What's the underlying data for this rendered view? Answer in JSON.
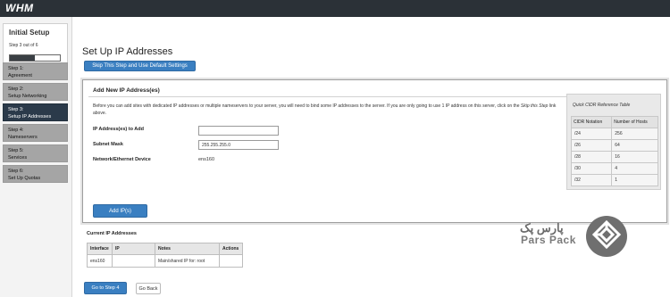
{
  "app": {
    "logo_text": "WHM"
  },
  "sidebar": {
    "setup_title": "Initial Setup",
    "setup_progress_text": "Step 3 out of 6",
    "progress_fraction": 0.5,
    "steps": [
      {
        "num": "Step 1:",
        "title": "Agreement",
        "active": false
      },
      {
        "num": "Step 2:",
        "title": "Setup Networking",
        "active": false
      },
      {
        "num": "Step 3:",
        "title": "Setup IP Addresses",
        "active": true
      },
      {
        "num": "Step 4:",
        "title": "Nameservers",
        "active": false
      },
      {
        "num": "Step 5:",
        "title": "Services",
        "active": false
      },
      {
        "num": "Step 6:",
        "title": "Set Up Quotas",
        "active": false
      }
    ]
  },
  "main": {
    "title": "Set Up IP Addresses",
    "skip_button": "Skip This Step and Use Default Settings",
    "panel_title": "Add New IP Address(es)",
    "description_part1": "Before you can add sites with dedicated IP addresses or multiple nameservers to your server, you will need to bind some IP addresses to the server. If you are only going to use 1 IP address on this server, click on the ",
    "description_link": "Skip this Step",
    "description_part2": " link above.",
    "form": {
      "ip_label": "IP Address(es) to Add",
      "ip_value": "",
      "subnet_label": "Subnet Mask",
      "subnet_value": "255.255.255.0",
      "device_label": "Network/Ethernet Device",
      "device_value": "ens160"
    },
    "add_button": "Add IP(s)",
    "cidr_table": {
      "title": "Quick CIDR Reference Table",
      "headers": [
        "CIDR Notation",
        "Number of Hosts"
      ],
      "rows": [
        [
          "/24",
          "256"
        ],
        [
          "/26",
          "64"
        ],
        [
          "/28",
          "16"
        ],
        [
          "/30",
          "4"
        ],
        [
          "/32",
          "1"
        ]
      ]
    },
    "current_title": "Current IP Addresses",
    "current_table": {
      "headers": [
        "Interface",
        "IP",
        "Notes",
        "Actions"
      ],
      "rows": [
        [
          "ens160",
          "",
          "Main/shared IP for: root",
          ""
        ]
      ]
    },
    "next_button": "Go to Step 4",
    "back_button": "Go Back"
  },
  "watermark": {
    "text_fa": "پارس پک",
    "text_en": "Pars Pack"
  },
  "colors": {
    "accent": "#3a7fc1",
    "topbar": "#2b3137",
    "active_step": "#2b3a4a"
  }
}
